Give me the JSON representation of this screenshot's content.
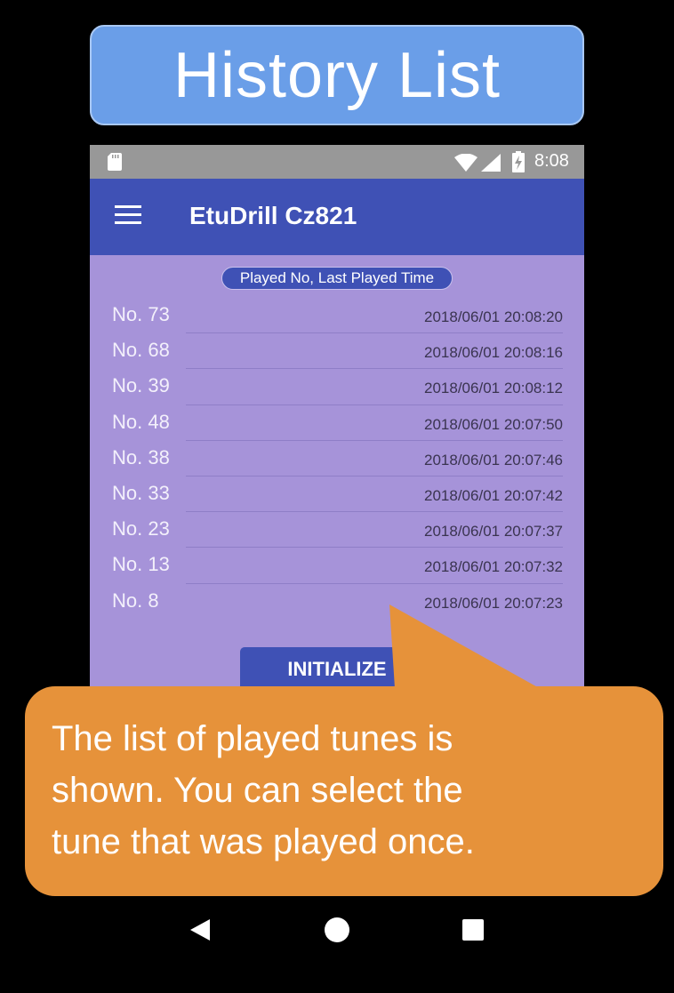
{
  "banner": {
    "title": "History List"
  },
  "status_bar": {
    "time": "8:08",
    "icons": [
      "sd-card-icon",
      "wifi-icon",
      "signal-icon",
      "battery-charging-icon"
    ]
  },
  "app_bar": {
    "title": "EtuDrill Cz821",
    "menu_icon": "hamburger-menu-icon"
  },
  "list_header": "Played No, Last Played Time",
  "history": [
    {
      "no": "No. 73",
      "time": "2018/06/01 20:08:20"
    },
    {
      "no": "No. 68",
      "time": "2018/06/01 20:08:16"
    },
    {
      "no": "No. 39",
      "time": "2018/06/01 20:08:12"
    },
    {
      "no": "No. 48",
      "time": "2018/06/01 20:07:50"
    },
    {
      "no": "No. 38",
      "time": "2018/06/01 20:07:46"
    },
    {
      "no": "No. 33",
      "time": "2018/06/01 20:07:42"
    },
    {
      "no": "No. 23",
      "time": "2018/06/01 20:07:37"
    },
    {
      "no": "No. 13",
      "time": "2018/06/01 20:07:32"
    },
    {
      "no": "No. 8",
      "time": "2018/06/01 20:07:23"
    }
  ],
  "initialize_button": "INITIALIZE",
  "callout": {
    "lines": [
      "The list of played tunes is",
      "shown. You can select the",
      "tune that was played once."
    ]
  },
  "nav_bar": {
    "icons": [
      "back-icon",
      "home-icon",
      "recents-icon"
    ]
  },
  "colors": {
    "banner": "#6a9ee8",
    "app_bar": "#3f51b5",
    "list_background": "#a693d9",
    "callout": "#e6923a",
    "status_bar": "#989898"
  }
}
